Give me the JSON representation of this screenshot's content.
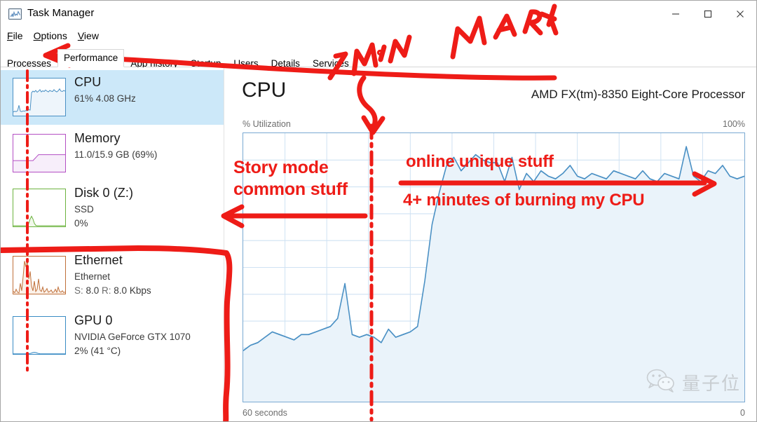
{
  "window": {
    "title": "Task Manager",
    "app_icon": "task-manager-icon",
    "minimize": "–",
    "maximize": "□",
    "close": "✕"
  },
  "menu": {
    "items": [
      {
        "label": "File",
        "accel": "F"
      },
      {
        "label": "Options",
        "accel": "O"
      },
      {
        "label": "View",
        "accel": "V"
      }
    ]
  },
  "tabs": {
    "items": [
      {
        "label": "Processes",
        "active": false
      },
      {
        "label": "Performance",
        "active": true
      },
      {
        "label": "App history",
        "active": false
      },
      {
        "label": "Startup",
        "active": false
      },
      {
        "label": "Users",
        "active": false
      },
      {
        "label": "Details",
        "active": false
      },
      {
        "label": "Services",
        "active": false
      }
    ]
  },
  "sidebar": {
    "items": [
      {
        "name": "CPU",
        "line1": "61%  4.08 GHz",
        "line2": "",
        "selected": true,
        "color": "#4a90c4",
        "fill": "#eef5fb"
      },
      {
        "name": "Memory",
        "line1": "11.0/15.9 GB (69%)",
        "line2": "",
        "selected": false,
        "color": "#b44fc4",
        "fill": "#f7eefa"
      },
      {
        "name": "Disk 0 (Z:)",
        "line1": "SSD",
        "line2": "0%",
        "selected": false,
        "color": "#6cb33f",
        "fill": "#f0f8ea"
      },
      {
        "name": "Ethernet",
        "line1": "Ethernet",
        "line2": "S: 8.0  R: 8.0 Kbps",
        "line2_s_label": "S:",
        "line2_s_value": "8.0",
        "line2_r_label": "R:",
        "line2_r_value": "8.0 Kbps",
        "selected": false,
        "color": "#c0703a",
        "fill": "#fbf1e9"
      },
      {
        "name": "GPU 0",
        "line1": "NVIDIA GeForce GTX 1070",
        "line2": "2%  (41 °C)",
        "selected": false,
        "color": "#3a8cc4",
        "fill": "#eef5fb"
      }
    ]
  },
  "main": {
    "heading": "CPU",
    "model": "AMD FX(tm)-8350 Eight-Core Processor",
    "axis_top_left": "% Utilization",
    "axis_top_right": "100%",
    "axis_bottom_left": "60 seconds",
    "axis_bottom_right": "0",
    "watermark_text": "量子位",
    "watermark_icon": "wechat-icon"
  },
  "annotations": {
    "accent_color": "#ee1c17",
    "story_mode_line1": "Story mode",
    "story_mode_line2": "common stuff",
    "online_unique": "online unique stuff",
    "burning_cpu": "4+ minutes of burning my CPU",
    "hand_min": "1 MIN",
    "hand_mark": "MARK"
  },
  "chart_data": {
    "type": "area",
    "title": "CPU",
    "subtitle": "AMD FX(tm)-8350 Eight-Core Processor",
    "ylabel": "% Utilization",
    "ylim": [
      0,
      100
    ],
    "xlabel": "60 seconds",
    "xlim": [
      60,
      0
    ],
    "x_tick_labels": [
      "60 seconds",
      "0"
    ],
    "y_tick_labels": [
      "100%"
    ],
    "grid": true,
    "grid_columns": 12,
    "grid_rows": 10,
    "line_color": "#4a90c4",
    "fill_color": "#eaf3fa",
    "marker_line": {
      "label": "1 MIN MARK",
      "x_percent": 46.5,
      "color": "#ee1c17",
      "style": "dash-dot"
    },
    "values": [
      19,
      21,
      22,
      24,
      26,
      25,
      24,
      23,
      25,
      25,
      26,
      27,
      28,
      31,
      44,
      25,
      24,
      25,
      24,
      22,
      27,
      24,
      25,
      26,
      28,
      45,
      66,
      78,
      88,
      91,
      86,
      89,
      92,
      90,
      89,
      89,
      82,
      91,
      79,
      85,
      82,
      86,
      84,
      83,
      85,
      88,
      84,
      83,
      85,
      84,
      83,
      86,
      85,
      84,
      83,
      86,
      83,
      82,
      85,
      84,
      83,
      95,
      84,
      82,
      86,
      85,
      88,
      84,
      83,
      84
    ]
  }
}
